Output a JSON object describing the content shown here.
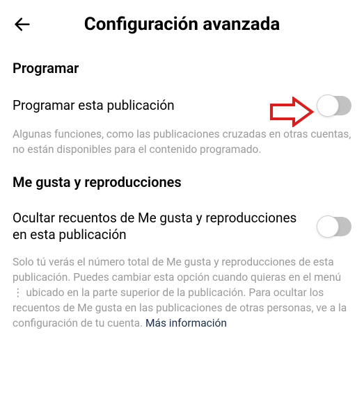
{
  "header": {
    "title": "Configuración avanzada"
  },
  "programar": {
    "section_title": "Programar",
    "setting_label": "Programar esta publicación",
    "description": "Algunas funciones, como las publicaciones cruzadas en otras cuentas, no están disponibles para el contenido programado."
  },
  "megusta": {
    "section_title": "Me gusta y reproducciones",
    "setting_label": "Ocultar recuentos de Me gusta y reproducciones en esta publicación",
    "description": "Solo tú verás el número total de Me gusta y reproducciones de esta publicación. Puedes cambiar esta opción cuando quieras en el menú ⋮ ubicado en la parte superior de la publicación. Para ocultar los recuentos de Me gusta en las publicaciones de otras personas, ve a la configuración de tu cuenta. ",
    "more_info": "Más información"
  }
}
